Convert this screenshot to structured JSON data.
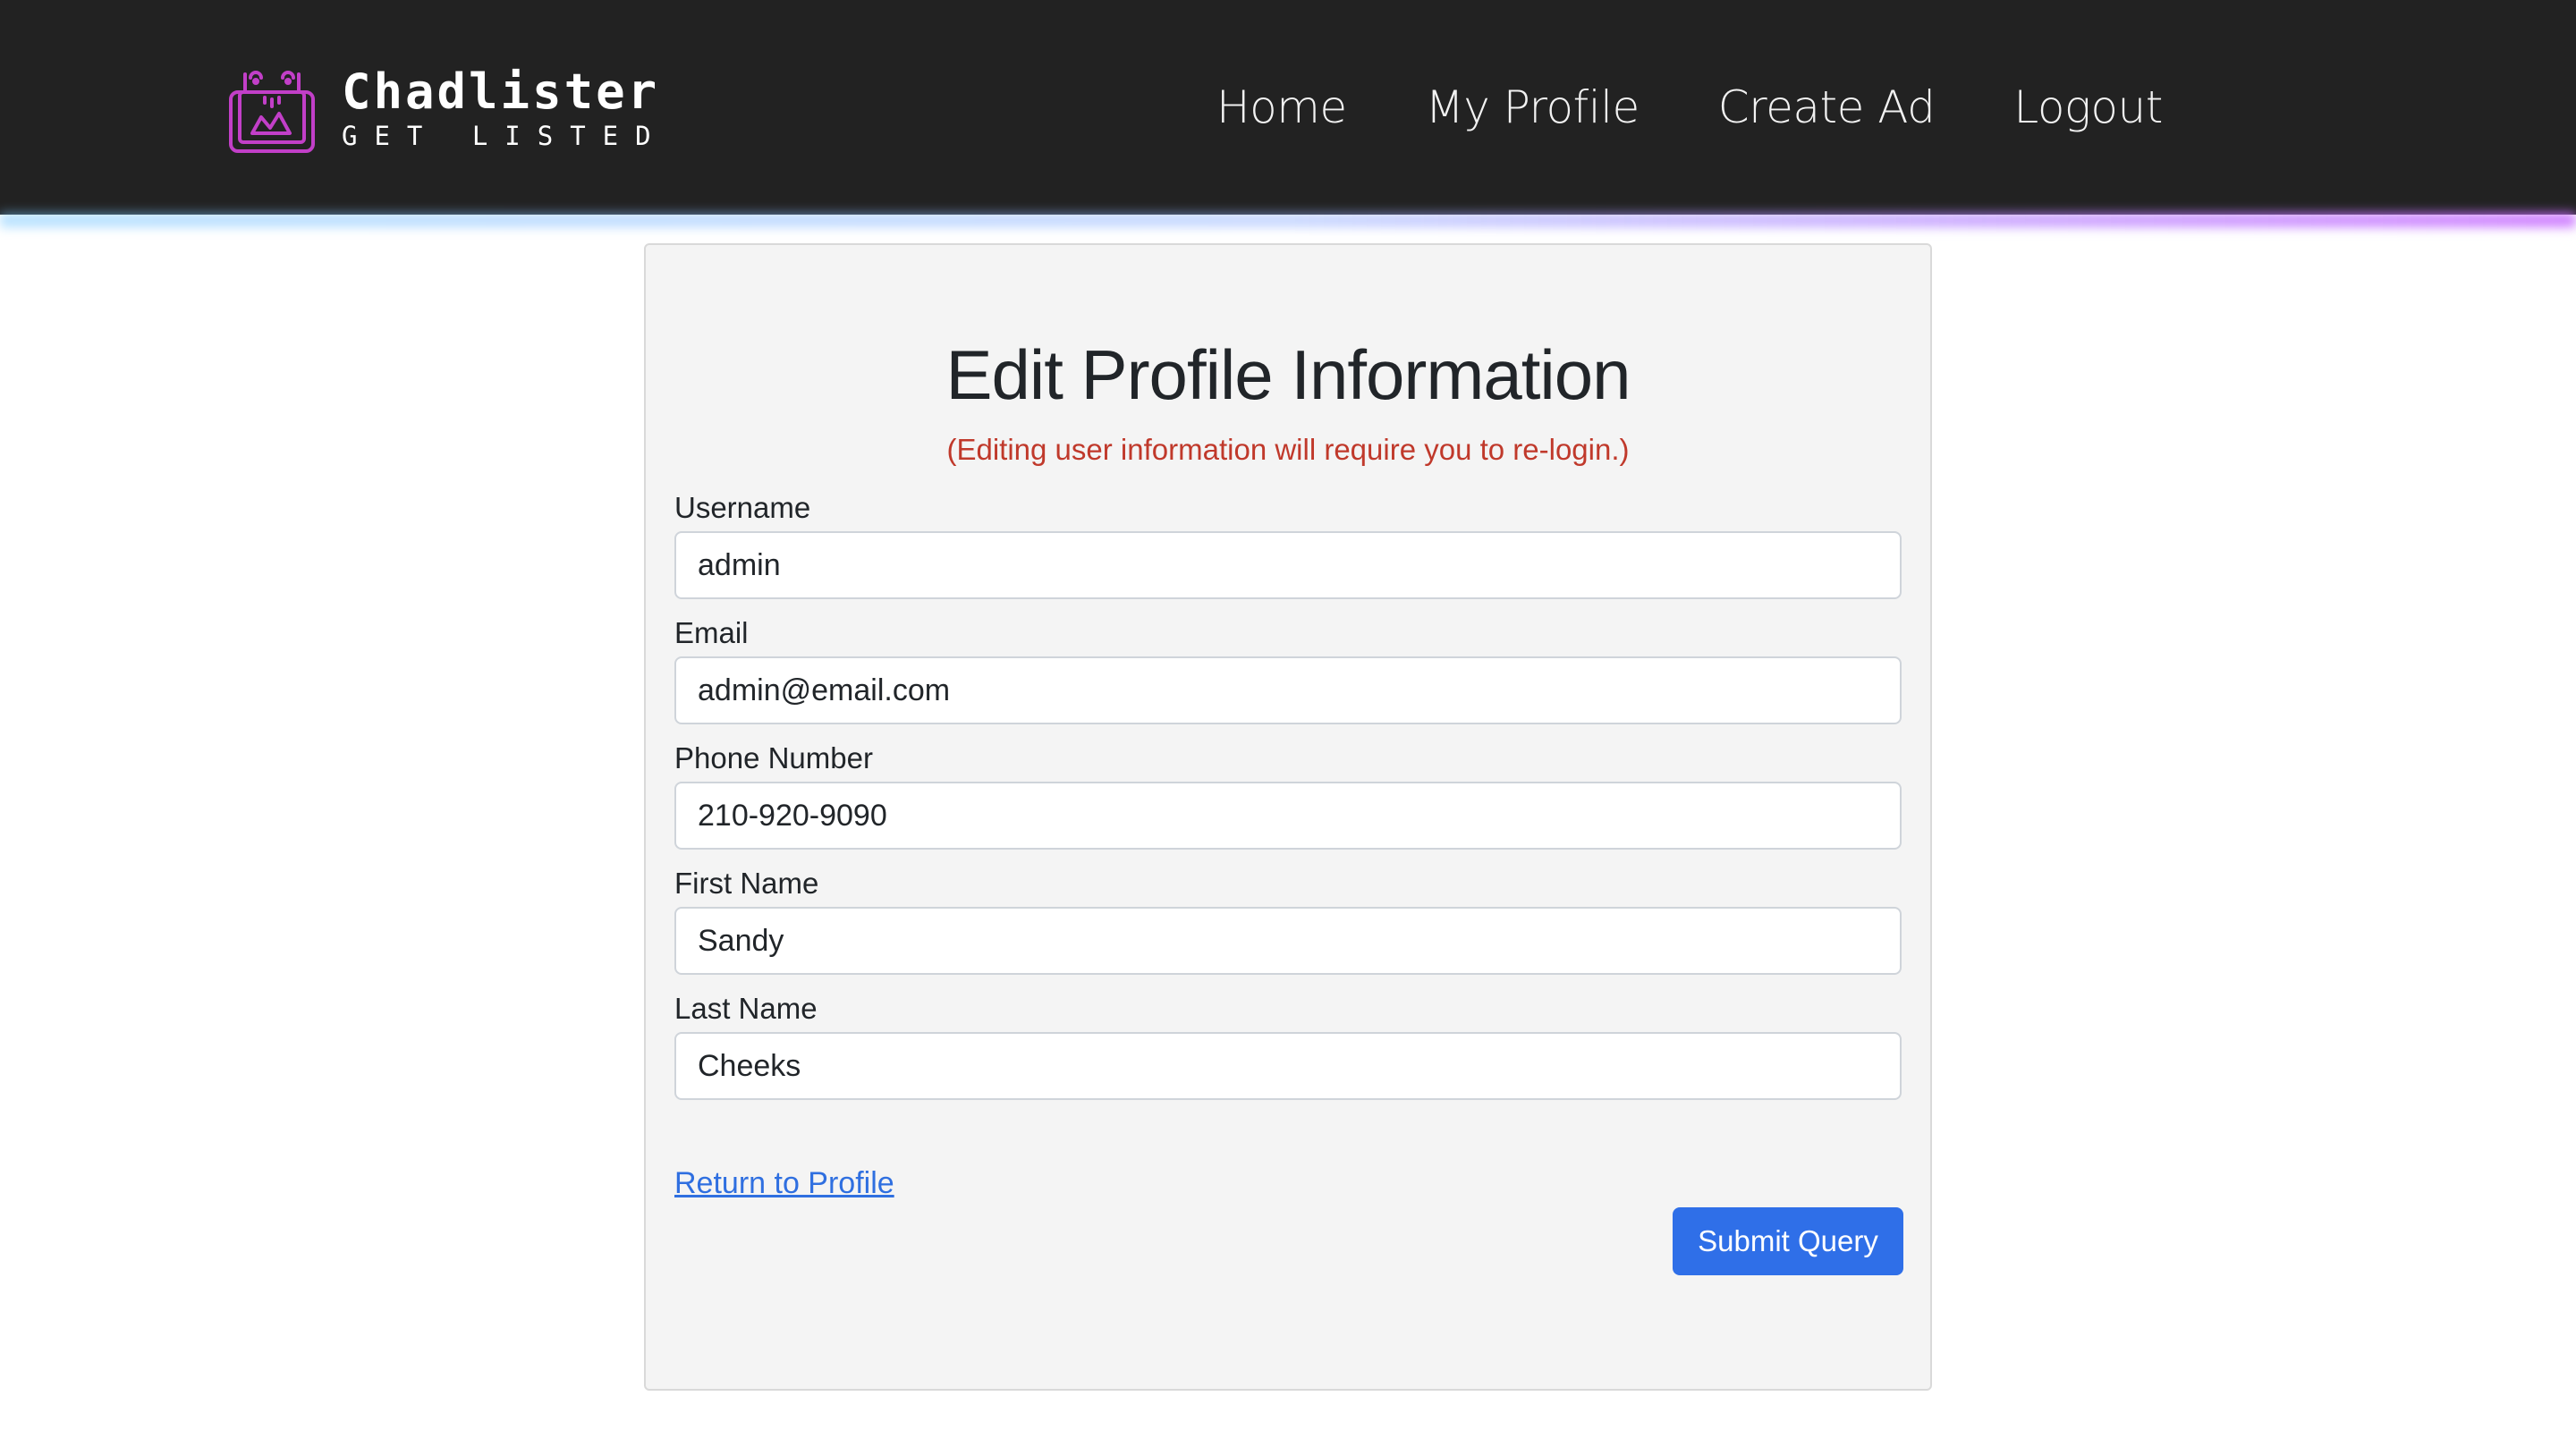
{
  "brand": {
    "name": "Chadlister",
    "tagline": "GET LISTED",
    "logo_icon": "shopping-bag-icon",
    "accent": "#c23fc8"
  },
  "nav": {
    "items": [
      {
        "label": "Home"
      },
      {
        "label": "My Profile"
      },
      {
        "label": "Create Ad"
      },
      {
        "label": "Logout"
      }
    ]
  },
  "form": {
    "title": "Edit Profile Information",
    "note": "(Editing user information will require you to re-login.)",
    "note_color": "#c0392b",
    "fields": [
      {
        "label": "Username",
        "value": "admin"
      },
      {
        "label": "Email",
        "value": "admin@email.com"
      },
      {
        "label": "Phone Number",
        "value": "210-920-9090"
      },
      {
        "label": "First Name",
        "value": "Sandy"
      },
      {
        "label": "Last Name",
        "value": "Cheeks"
      }
    ],
    "return_link": "Return to Profile",
    "submit_label": "Submit Query",
    "submit_color": "#2f6fe8"
  }
}
